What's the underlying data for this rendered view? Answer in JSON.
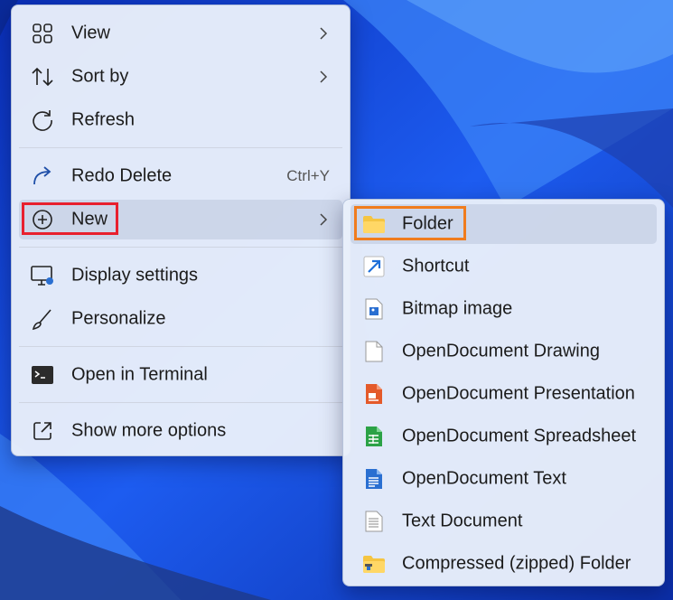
{
  "colors": {
    "accent_red": "#e8202e",
    "accent_orange": "#f07c1e",
    "folder_yellow": "#f5c542",
    "presentation_orange": "#e45a2a",
    "spreadsheet_green": "#2ba246",
    "text_blue": "#2a6fd1"
  },
  "context_menu": {
    "items": [
      {
        "label": "View",
        "icon": "grid-icon",
        "submenu": true
      },
      {
        "label": "Sort by",
        "icon": "sort-icon",
        "submenu": true
      },
      {
        "label": "Refresh",
        "icon": "refresh-icon"
      },
      {
        "label": "Redo Delete",
        "icon": "redo-icon",
        "shortcut": "Ctrl+Y"
      },
      {
        "label": "New",
        "icon": "plus-circle-icon",
        "submenu": true,
        "selected": true
      },
      {
        "label": "Display settings",
        "icon": "display-icon"
      },
      {
        "label": "Personalize",
        "icon": "brush-icon"
      },
      {
        "label": "Open in Terminal",
        "icon": "terminal-icon"
      },
      {
        "label": "Show more options",
        "icon": "external-icon"
      }
    ]
  },
  "new_submenu": {
    "items": [
      {
        "label": "Folder",
        "icon": "folder-icon",
        "selected": true
      },
      {
        "label": "Shortcut",
        "icon": "shortcut-icon"
      },
      {
        "label": "Bitmap image",
        "icon": "bitmap-icon"
      },
      {
        "label": "OpenDocument Drawing",
        "icon": "drawing-icon"
      },
      {
        "label": "OpenDocument Presentation",
        "icon": "presentation-icon"
      },
      {
        "label": "OpenDocument Spreadsheet",
        "icon": "spreadsheet-icon"
      },
      {
        "label": "OpenDocument Text",
        "icon": "odt-icon"
      },
      {
        "label": "Text Document",
        "icon": "text-document-icon"
      },
      {
        "label": "Compressed (zipped) Folder",
        "icon": "zip-folder-icon"
      }
    ]
  }
}
